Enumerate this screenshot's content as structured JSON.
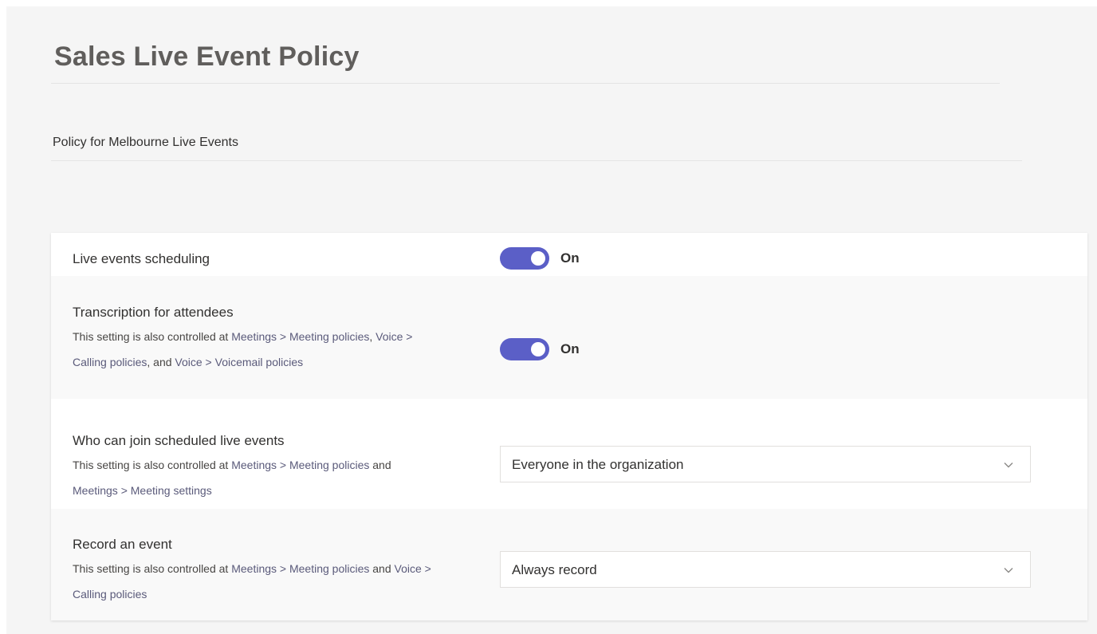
{
  "page": {
    "title": "Sales Live Event Policy",
    "description": "Policy for Melbourne Live Events"
  },
  "settings": [
    {
      "label": "Live events scheduling",
      "control": "toggle",
      "state": "On"
    },
    {
      "label": "Transcription for attendees",
      "control": "toggle",
      "state": "On",
      "help_parts": [
        {
          "text": "This setting is also controlled at ",
          "link": false
        },
        {
          "text": "Meetings > Meeting policies",
          "link": true
        },
        {
          "text": ", ",
          "link": false
        },
        {
          "text": "Voice > Calling policies",
          "link": true
        },
        {
          "text": ", and ",
          "link": false
        },
        {
          "text": "Voice > Voicemail policies",
          "link": true
        }
      ]
    },
    {
      "label": "Who can join scheduled live events",
      "control": "dropdown",
      "value": "Everyone in the organization",
      "help_parts": [
        {
          "text": "This setting is also controlled at ",
          "link": false
        },
        {
          "text": "Meetings > Meeting policies",
          "link": true
        },
        {
          "text": " and ",
          "link": false
        },
        {
          "text": "Meetings > Meeting settings",
          "link": true
        }
      ]
    },
    {
      "label": "Record an event",
      "control": "dropdown",
      "value": "Always record",
      "help_parts": [
        {
          "text": "This setting is also controlled at ",
          "link": false
        },
        {
          "text": "Meetings > Meeting policies",
          "link": true
        },
        {
          "text": " and ",
          "link": false
        },
        {
          "text": "Voice > Calling policies",
          "link": true
        }
      ]
    }
  ],
  "colors": {
    "toggle_on": "#5b5fc7",
    "background": "#f5f5f5",
    "card": "#ffffff"
  },
  "icons": {
    "dropdown": "chevron-down-icon"
  }
}
